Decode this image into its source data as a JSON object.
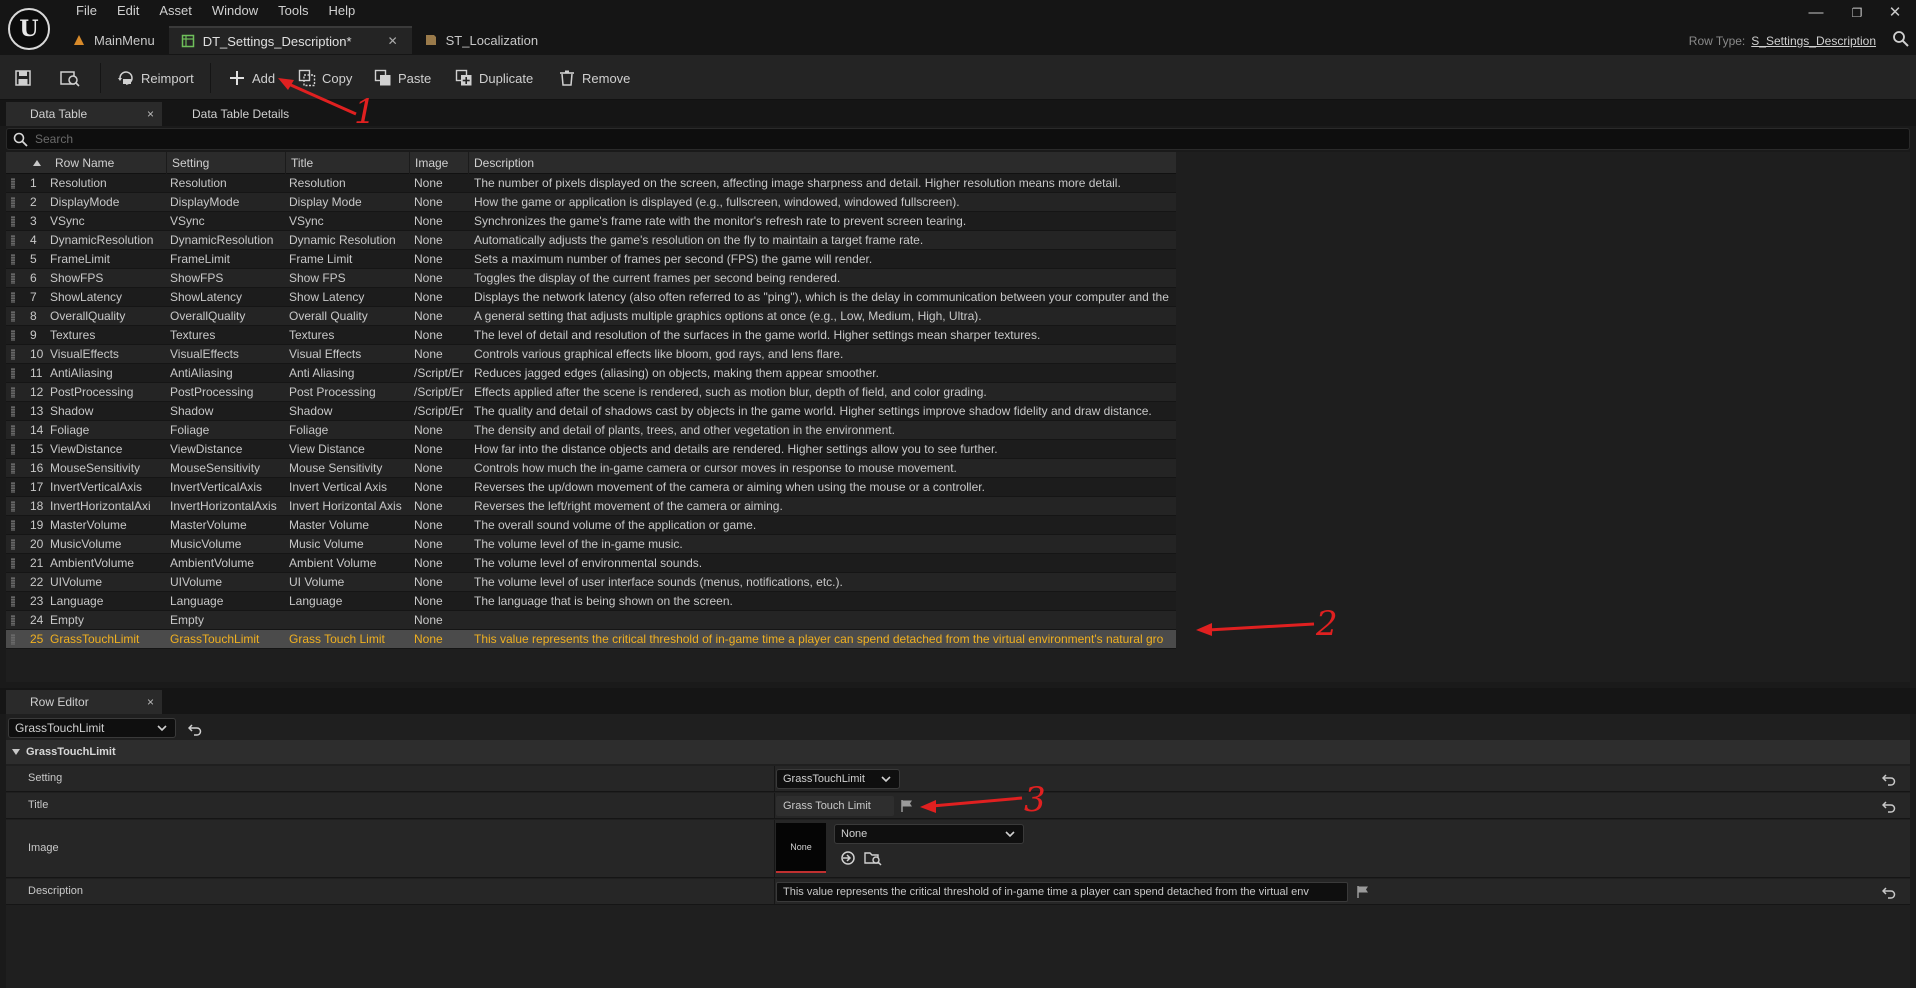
{
  "menu": [
    "File",
    "Edit",
    "Asset",
    "Window",
    "Tools",
    "Help"
  ],
  "doc_tabs": [
    {
      "label": "MainMenu"
    },
    {
      "label": "DT_Settings_Description*"
    },
    {
      "label": "ST_Localization"
    }
  ],
  "row_type": {
    "label": "Row Type:",
    "value": "S_Settings_Description"
  },
  "toolbar": {
    "reimport": "Reimport",
    "add": "Add",
    "copy": "Copy",
    "paste": "Paste",
    "duplicate": "Duplicate",
    "remove": "Remove"
  },
  "panel_tabs": {
    "data_table": "Data Table",
    "details": "Data Table Details",
    "close": "×"
  },
  "search": {
    "placeholder": "Search"
  },
  "table": {
    "columns": [
      "Row Name",
      "Setting",
      "Title",
      "Image",
      "Description"
    ],
    "rows": [
      {
        "n": "1",
        "name": "Resolution",
        "setting": "Resolution",
        "title": "Resolution",
        "image": "None",
        "desc": "The number of pixels displayed on the screen, affecting image sharpness and detail. Higher resolution means more detail."
      },
      {
        "n": "2",
        "name": "DisplayMode",
        "setting": "DisplayMode",
        "title": "Display Mode",
        "image": "None",
        "desc": "How the game or application is displayed (e.g., fullscreen, windowed, windowed fullscreen)."
      },
      {
        "n": "3",
        "name": "VSync",
        "setting": "VSync",
        "title": "VSync",
        "image": "None",
        "desc": "Synchronizes the game's frame rate with the monitor's refresh rate to prevent screen tearing."
      },
      {
        "n": "4",
        "name": "DynamicResolution",
        "setting": "DynamicResolution",
        "title": "Dynamic Resolution",
        "image": "None",
        "desc": "Automatically adjusts the game's resolution on the fly to maintain a target frame rate."
      },
      {
        "n": "5",
        "name": "FrameLimit",
        "setting": "FrameLimit",
        "title": "Frame Limit",
        "image": "None",
        "desc": "Sets a maximum number of frames per second (FPS) the game will render."
      },
      {
        "n": "6",
        "name": "ShowFPS",
        "setting": "ShowFPS",
        "title": "Show FPS",
        "image": "None",
        "desc": "Toggles the display of the current frames per second being rendered."
      },
      {
        "n": "7",
        "name": "ShowLatency",
        "setting": "ShowLatency",
        "title": "Show Latency",
        "image": "None",
        "desc": "Displays the network latency (also often referred to as \"ping\"), which is the delay in communication between your computer and the"
      },
      {
        "n": "8",
        "name": "OverallQuality",
        "setting": "OverallQuality",
        "title": "Overall Quality",
        "image": "None",
        "desc": "A general setting that adjusts multiple graphics options at once (e.g., Low, Medium, High, Ultra)."
      },
      {
        "n": "9",
        "name": "Textures",
        "setting": "Textures",
        "title": "Textures",
        "image": "None",
        "desc": "The level of detail and resolution of the surfaces in the game world. Higher settings mean sharper textures."
      },
      {
        "n": "10",
        "name": "VisualEffects",
        "setting": "VisualEffects",
        "title": "Visual Effects",
        "image": "None",
        "desc": "Controls various graphical effects like bloom, god rays, and lens flare."
      },
      {
        "n": "11",
        "name": "AntiAliasing",
        "setting": "AntiAliasing",
        "title": "Anti Aliasing",
        "image": "/Script/Er",
        "desc": "Reduces jagged edges (aliasing) on objects, making them appear smoother."
      },
      {
        "n": "12",
        "name": "PostProcessing",
        "setting": "PostProcessing",
        "title": "Post Processing",
        "image": "/Script/Er",
        "desc": "Effects applied after the scene is rendered, such as motion blur, depth of field, and color grading."
      },
      {
        "n": "13",
        "name": "Shadow",
        "setting": "Shadow",
        "title": "Shadow",
        "image": "/Script/Er",
        "desc": "The quality and detail of shadows cast by objects in the game world. Higher settings improve shadow fidelity and draw distance."
      },
      {
        "n": "14",
        "name": "Foliage",
        "setting": "Foliage",
        "title": "Foliage",
        "image": "None",
        "desc": "The density and detail of plants, trees, and other vegetation in the environment."
      },
      {
        "n": "15",
        "name": "ViewDistance",
        "setting": "ViewDistance",
        "title": "View Distance",
        "image": "None",
        "desc": "How far into the distance objects and details are rendered. Higher settings allow you to see further."
      },
      {
        "n": "16",
        "name": "MouseSensitivity",
        "setting": "MouseSensitivity",
        "title": "Mouse Sensitivity",
        "image": "None",
        "desc": "Controls how much the in-game camera or cursor moves in response to mouse movement."
      },
      {
        "n": "17",
        "name": "InvertVerticalAxis",
        "setting": "InvertVerticalAxis",
        "title": "Invert Vertical Axis",
        "image": "None",
        "desc": "Reverses the up/down movement of the camera or aiming when using the mouse or a controller."
      },
      {
        "n": "18",
        "name": "InvertHorizontalAxi",
        "setting": "InvertHorizontalAxis",
        "title": "Invert Horizontal Axis",
        "image": "None",
        "desc": "Reverses the left/right movement of the camera or aiming."
      },
      {
        "n": "19",
        "name": "MasterVolume",
        "setting": "MasterVolume",
        "title": "Master Volume",
        "image": "None",
        "desc": "The overall sound volume of the application or game."
      },
      {
        "n": "20",
        "name": "MusicVolume",
        "setting": "MusicVolume",
        "title": "Music Volume",
        "image": "None",
        "desc": "The volume level of the in-game music."
      },
      {
        "n": "21",
        "name": "AmbientVolume",
        "setting": "AmbientVolume",
        "title": "Ambient Volume",
        "image": "None",
        "desc": "The volume level of environmental sounds."
      },
      {
        "n": "22",
        "name": "UIVolume",
        "setting": "UIVolume",
        "title": "UI Volume",
        "image": "None",
        "desc": "The volume level of user interface sounds (menus, notifications, etc.)."
      },
      {
        "n": "23",
        "name": "Language",
        "setting": "Language",
        "title": "Language",
        "image": "None",
        "desc": "The language that is being shown on the screen."
      },
      {
        "n": "24",
        "name": "Empty",
        "setting": "Empty",
        "title": "",
        "image": "None",
        "desc": ""
      },
      {
        "n": "25",
        "name": "GrassTouchLimit",
        "setting": "GrassTouchLimit",
        "title": "Grass Touch Limit",
        "image": "None",
        "desc": "This value represents the critical threshold of in-game time a player can spend detached from the virtual environment's natural gro"
      }
    ]
  },
  "annotations": [
    "1",
    "2",
    "3"
  ],
  "row_editor": {
    "tab": "Row Editor",
    "selected_row": "GrassTouchLimit",
    "section": "GrassTouchLimit",
    "fields": {
      "setting": {
        "label": "Setting",
        "value": "GrassTouchLimit"
      },
      "title": {
        "label": "Title",
        "value": "Grass Touch Limit"
      },
      "image": {
        "label": "Image",
        "thumb": "None",
        "value": "None"
      },
      "description": {
        "label": "Description",
        "value": "This value represents the critical threshold of in-game time a player can spend detached from the virtual env"
      }
    }
  },
  "colors": {
    "selected_text": "#f0b020",
    "annotation": "#e02020",
    "background": "#1a1a1a"
  }
}
